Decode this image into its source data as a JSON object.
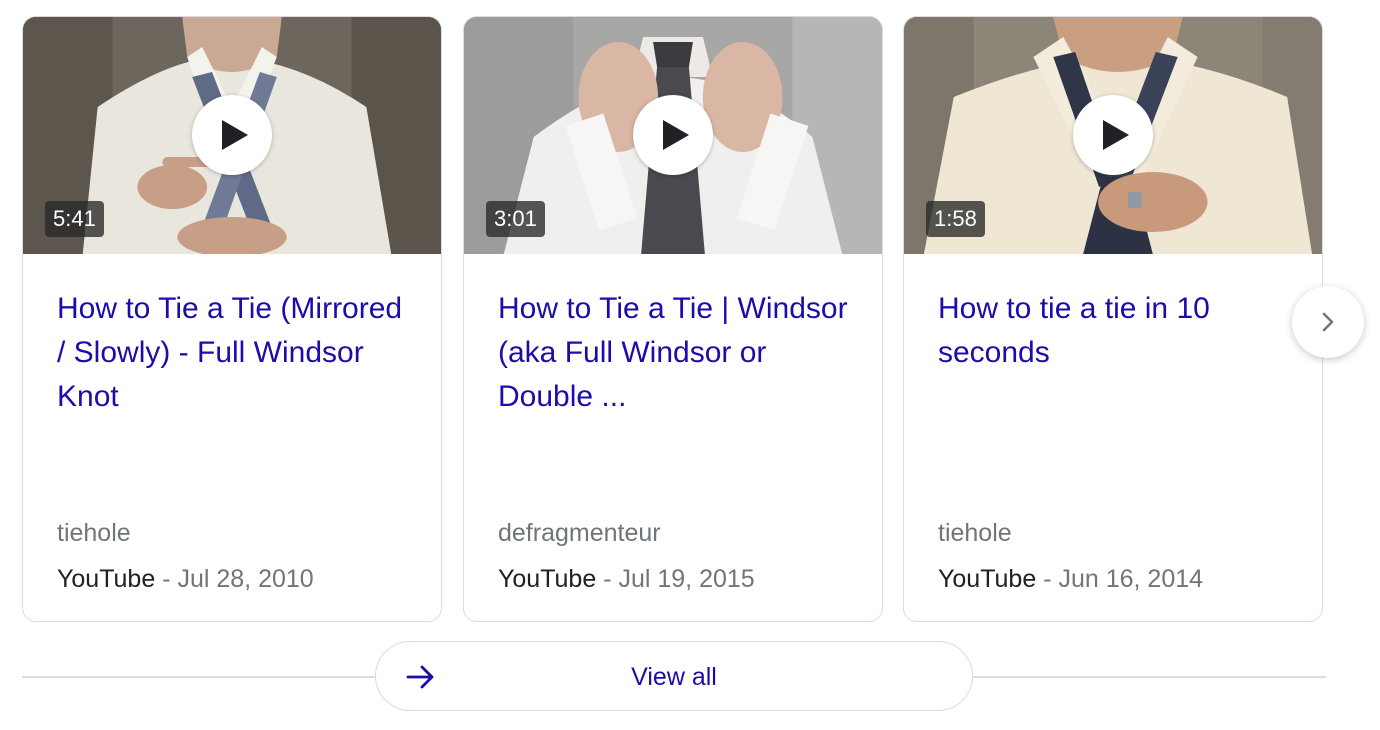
{
  "cards": [
    {
      "duration": "5:41",
      "title": "How to Tie a Tie (Mirrored / Slowly) - Full Windsor Knot",
      "channel": "tiehole",
      "source": "YouTube",
      "separator": " - ",
      "date": "Jul 28, 2010"
    },
    {
      "duration": "3:01",
      "title": "How to Tie a Tie | Windsor (aka Full Windsor or Double ...",
      "channel": "defragmenteur",
      "source": "YouTube",
      "separator": " - ",
      "date": "Jul 19, 2015"
    },
    {
      "duration": "1:58",
      "title": "How to tie a tie in 10 seconds",
      "channel": "tiehole",
      "source": "YouTube",
      "separator": " - ",
      "date": "Jun 16, 2014"
    }
  ],
  "view_all": {
    "label": "View all",
    "icon": "arrow-right-icon"
  },
  "next_button": {
    "icon": "chevron-right-icon"
  },
  "colors": {
    "link": "#1a0dab",
    "meta": "#70757a",
    "source": "#202124",
    "border": "#dadce0"
  }
}
